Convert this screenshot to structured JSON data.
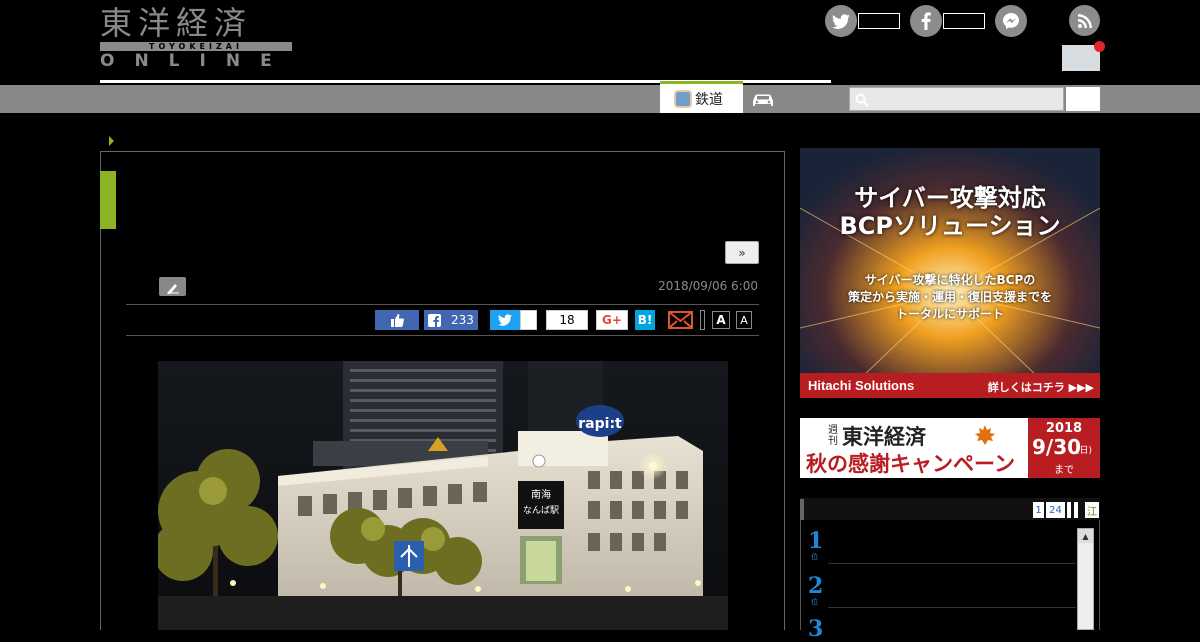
{
  "site": {
    "logo_main": "東洋経済",
    "logo_roman": "TOYOKEIZAI",
    "logo_sub": "ONLINE"
  },
  "header": {
    "sns": [
      {
        "name": "twitter",
        "glyph": "t"
      },
      {
        "name": "facebook",
        "glyph": "f"
      },
      {
        "name": "messenger",
        "glyph": "m"
      },
      {
        "name": "rss",
        "glyph": "rss"
      }
    ]
  },
  "nav": {
    "tabs": [
      {
        "label": "鉄道",
        "icon": "train-icon",
        "active": true
      },
      {
        "label": "",
        "icon": "car-icon",
        "active": false
      }
    ],
    "search": {
      "placeholder": "",
      "value": ""
    }
  },
  "article": {
    "more_label": "»",
    "date": "2018/09/06 6:00",
    "share": {
      "facebook_share_count": "233",
      "hatena_count": "18",
      "gplus_label": "G+",
      "hatena_label": "B!",
      "font_large": "A",
      "font_small": "A"
    }
  },
  "sidebar": {
    "ad1": {
      "headline_1": "サイバー攻撃対応",
      "headline_2": "BCPソリューション",
      "body_1": "サイバー攻撃に特化したBCPの",
      "body_2": "策定から実施・運用・復旧支援までを",
      "body_3": "トータルにサポート",
      "brand": "Hitachi Solutions",
      "cta": "詳しくはコチラ ▶▶▶"
    },
    "ad2": {
      "weekly": "週刊",
      "title": "東洋経済",
      "campaign": "秋の感謝キャンペーン",
      "year": "2018",
      "date": "9/30",
      "dow": "(日)",
      "until": "まで"
    },
    "ranking": {
      "tabs": [
        "1",
        "24"
      ],
      "extra_tab": "江",
      "items": [
        {
          "rank": "1",
          "suffix": "位"
        },
        {
          "rank": "2",
          "suffix": "位"
        },
        {
          "rank": "3",
          "suffix": "位"
        }
      ]
    }
  },
  "photo": {
    "sign_rapit": "rapi:t",
    "sign_nankai_1": "南海",
    "sign_nankai_2": "なんば駅",
    "colors": {
      "sky": "#0d1013",
      "building": "#d9d0c0",
      "tree": "#7a7a28",
      "sign": "#2a5fb0"
    }
  },
  "colors": {
    "accent": "#8cb423",
    "nav": "#888888",
    "facebook": "#4267b2",
    "twitter": "#1da1f2",
    "hatena": "#00a4de",
    "ranking_blue": "#1f87d6"
  }
}
